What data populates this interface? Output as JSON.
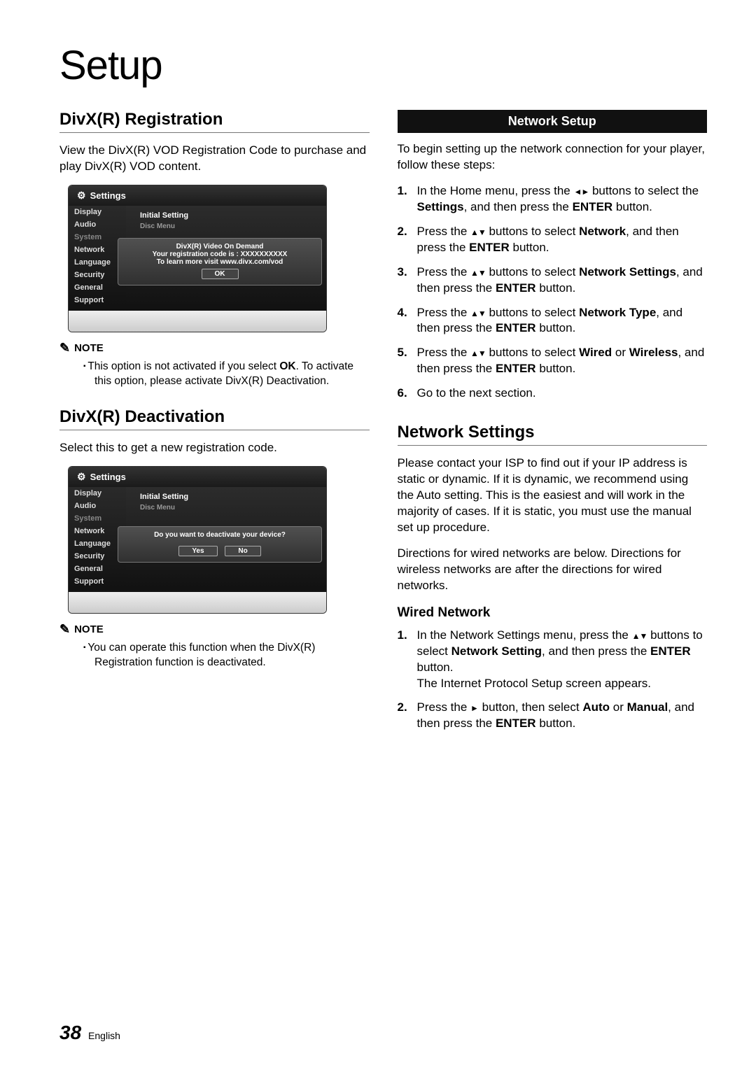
{
  "page": {
    "title": "Setup",
    "number": "38",
    "lang": "English"
  },
  "left": {
    "reg_heading": "DivX(R) Registration",
    "reg_body": "View the DivX(R) VOD Registration Code to purchase and play DivX(R) VOD content.",
    "note_label": "NOTE",
    "reg_note_prefix": "This option is not activated if you select ",
    "reg_note_bold": "OK",
    "reg_note_suffix": ". To activate this option, please activate DivX(R) Deactivation.",
    "deact_heading": "DivX(R) Deactivation",
    "deact_body": "Select this to get a new registration code.",
    "deact_note": "You can operate this function when the DivX(R) Registration function is deactivated."
  },
  "dialogs": {
    "settings_title": "Settings",
    "sidebar": [
      "Display",
      "Audio",
      "System",
      "Network",
      "Language",
      "Security",
      "General",
      "Support"
    ],
    "main_line1": "Initial Setting",
    "main_line2": "Disc Menu",
    "reg_popup": {
      "l1": "DivX(R) Video On Demand",
      "l2": "Your registration code is : XXXXXXXXXX",
      "l3": "To learn more visit www.divx.com/vod",
      "ok": "OK"
    },
    "deact_popup": {
      "l1": "Do you want to deactivate your device?",
      "yes": "Yes",
      "no": "No"
    }
  },
  "right": {
    "banner": "Network Setup",
    "intro": "To begin setting up the network connection for your player, follow these steps:",
    "steps": [
      {
        "pre": "In the Home menu, press the ",
        "arrow": "lr",
        "mid": " buttons to select the ",
        "b1": "Settings",
        "mid2": ", and then press the ",
        "b2": "ENTER",
        "post": " button."
      },
      {
        "pre": "Press the ",
        "arrow": "ud",
        "mid": " buttons to select ",
        "b1": "Network",
        "mid2": ", and then press the ",
        "b2": "ENTER",
        "post": " button."
      },
      {
        "pre": "Press the ",
        "arrow": "ud",
        "mid": " buttons to select ",
        "b1": "Network Settings",
        "mid2": ", and then press the ",
        "b2": "ENTER",
        "post": " button."
      },
      {
        "pre": "Press the ",
        "arrow": "ud",
        "mid": " buttons to select ",
        "b1": "Network Type",
        "mid2": ", and then press the ",
        "b2": "ENTER",
        "post": " button."
      },
      {
        "pre": "Press the ",
        "arrow": "ud",
        "mid": " buttons to select ",
        "b1": "Wired",
        "mid2": " or ",
        "b2": "Wireless",
        "mid3": ", and then press the ",
        "b3": "ENTER",
        "post": " button."
      },
      {
        "plain": "Go to the next section."
      }
    ],
    "net_settings_heading": "Network Settings",
    "net_settings_body1": "Please contact your ISP to find out if your IP address is static or dynamic. If it is dynamic, we recommend using the Auto setting. This is the easiest and will work in the majority of cases. If it is static, you must use the manual set up procedure.",
    "net_settings_body2": "Directions for wired networks are below. Directions for wireless networks are after the directions for wired networks.",
    "wired_heading": "Wired Network",
    "wired_steps": [
      {
        "pre": "In the Network Settings menu, press the ",
        "arrow": "ud",
        "mid": " buttons to select ",
        "b1": "Network Setting",
        "mid2": ", and then press the ",
        "b2": "ENTER",
        "post_line": " button.",
        "extra": "The Internet Protocol Setup screen appears."
      },
      {
        "pre": "Press the ",
        "arrow": "r",
        "mid": " button, then select ",
        "b1": "Auto",
        "mid2": " or ",
        "b2": "Manual",
        "mid3": ", and then press the ",
        "b3": "ENTER",
        "post": " button."
      }
    ]
  }
}
